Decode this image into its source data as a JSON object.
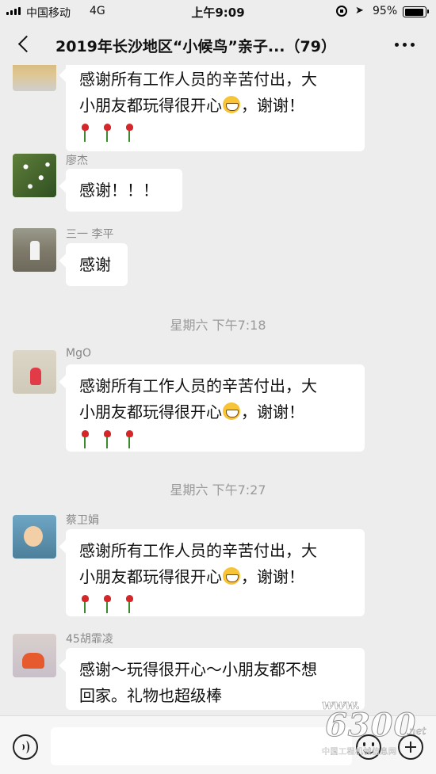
{
  "status_bar": {
    "carrier": "中国移动",
    "network": "4G",
    "time": "上午9:09",
    "battery": "95%",
    "battery_level": 0.95
  },
  "header": {
    "title": "2019年长沙地区“小候鸟”亲子...（79）"
  },
  "messages": [
    {
      "sender": "",
      "lines": [
        "感谢所有工作人员的辛苦付出，大",
        "小朋友都玩得很开心",
        "，谢谢！"
      ],
      "has_roses": true,
      "avatar_icon": "avatar-photo"
    },
    {
      "sender": "廖杰",
      "text": "感谢！！！",
      "avatar_icon": "avatar-flowers"
    },
    {
      "sender": "三一 李平",
      "text": "感谢",
      "avatar_icon": "avatar-man"
    },
    {
      "sender": "MgO",
      "lines": [
        "感谢所有工作人员的辛苦付出，大",
        "小朋友都玩得很开心",
        "，谢谢！"
      ],
      "has_roses": true,
      "avatar_icon": "avatar-child"
    },
    {
      "sender": "蔡卫娟",
      "lines": [
        "感谢所有工作人员的辛苦付出，大",
        "小朋友都玩得很开心",
        "，谢谢！"
      ],
      "has_roses": true,
      "avatar_icon": "avatar-boy"
    },
    {
      "sender": "45胡霏凌",
      "lines": [
        "感谢～玩得很开心～小朋友都不想",
        "回家。礼物也超级棒"
      ],
      "avatar_icon": "avatar-girl"
    }
  ],
  "timestamps": [
    "星期六 下午7:18",
    "星期六 下午7:27"
  ],
  "watermark": {
    "site": "www.",
    "number": "6300",
    "suffix": ".net",
    "org": "中国工程机械信息网"
  },
  "icons": [
    "signal-icon",
    "alarm-lock-icon",
    "location-icon",
    "battery-icon",
    "back-icon",
    "more-icon",
    "voice-icon",
    "emoji-icon",
    "plus-icon",
    "grin-emoji-icon",
    "rose-emoji-icon"
  ],
  "colors": {
    "background": "#ededed",
    "bubble": "#ffffff",
    "timestamp": "#9a9a9a",
    "sender": "#888888"
  }
}
